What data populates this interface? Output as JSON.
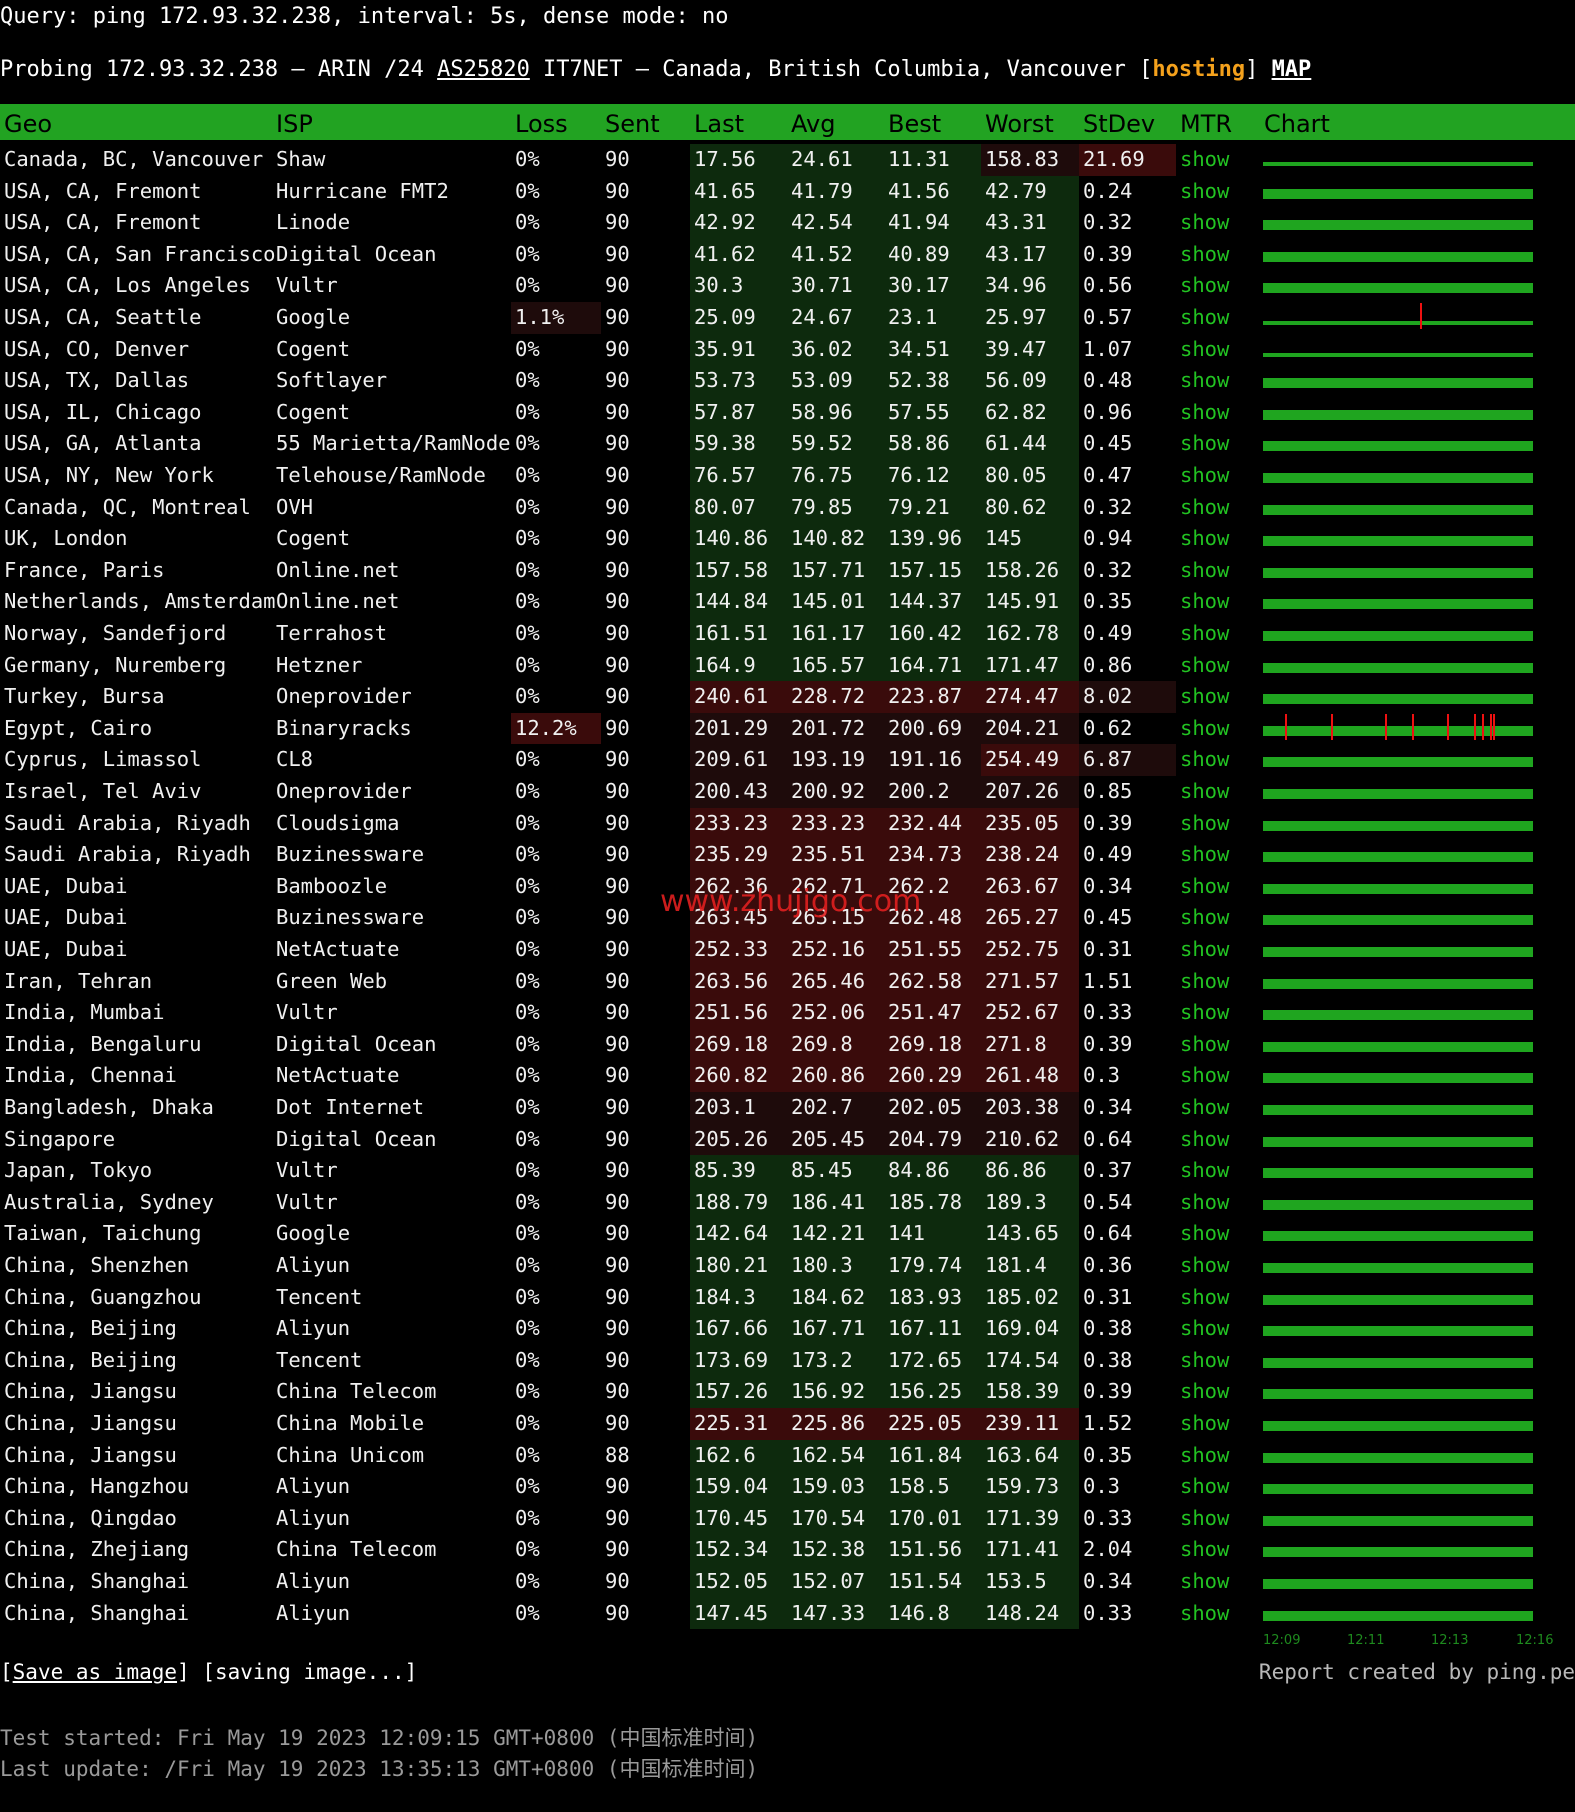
{
  "query": "Query: ping 172.93.32.238, interval: 5s, dense mode: no",
  "probe": {
    "prefix": "Probing 172.93.32.238 – ARIN /24 ",
    "asn": "AS25820",
    "suffix": " IT7NET – Canada, British Columbia, Vancouver [",
    "tag": "hosting",
    "close": "] ",
    "map": "MAP"
  },
  "headers": [
    "Geo",
    "ISP",
    "Loss",
    "Sent",
    "Last",
    "Avg",
    "Best",
    "Worst",
    "StDev",
    "MTR",
    "Chart"
  ],
  "colors": {
    "header_bg": "#22a322",
    "show_link": "#22c322",
    "hosting": "#f4a11c",
    "loss_spike": "#ee1111",
    "chart_bar": "#1fa51f"
  },
  "rows": [
    {
      "geo": "Canada, BC, Vancouver",
      "isp": "Shaw",
      "loss": "0%",
      "sent": "90",
      "last": "17.56",
      "avg": "24.61",
      "best": "11.31",
      "worst": "158.83",
      "stdev": "21.69",
      "mtr": "show",
      "lat": "green",
      "worst_flag": "dark",
      "stdev_flag": "red",
      "loss_flag": "none",
      "chart": "jitter",
      "spikes": []
    },
    {
      "geo": "USA, CA, Fremont",
      "isp": "Hurricane FMT2",
      "loss": "0%",
      "sent": "90",
      "last": "41.65",
      "avg": "41.79",
      "best": "41.56",
      "worst": "42.79",
      "stdev": "0.24",
      "mtr": "show",
      "lat": "green",
      "worst_flag": "green",
      "stdev_flag": "none",
      "loss_flag": "none",
      "chart": "solid",
      "spikes": []
    },
    {
      "geo": "USA, CA, Fremont",
      "isp": "Linode",
      "loss": "0%",
      "sent": "90",
      "last": "42.92",
      "avg": "42.54",
      "best": "41.94",
      "worst": "43.31",
      "stdev": "0.32",
      "mtr": "show",
      "lat": "green",
      "worst_flag": "green",
      "stdev_flag": "none",
      "loss_flag": "none",
      "chart": "solid",
      "spikes": []
    },
    {
      "geo": "USA, CA, San Francisco",
      "isp": "Digital Ocean",
      "loss": "0%",
      "sent": "90",
      "last": "41.62",
      "avg": "41.52",
      "best": "40.89",
      "worst": "43.17",
      "stdev": "0.39",
      "mtr": "show",
      "lat": "green",
      "worst_flag": "green",
      "stdev_flag": "none",
      "loss_flag": "none",
      "chart": "solid",
      "spikes": []
    },
    {
      "geo": "USA, CA, Los Angeles",
      "isp": "Vultr",
      "loss": "0%",
      "sent": "90",
      "last": "30.3",
      "avg": "30.71",
      "best": "30.17",
      "worst": "34.96",
      "stdev": "0.56",
      "mtr": "show",
      "lat": "green",
      "worst_flag": "green",
      "stdev_flag": "none",
      "loss_flag": "none",
      "chart": "solid",
      "spikes": []
    },
    {
      "geo": "USA, CA, Seattle",
      "isp": "Google",
      "loss": "1.1%",
      "sent": "90",
      "last": "25.09",
      "avg": "24.67",
      "best": "23.1",
      "worst": "25.97",
      "stdev": "0.57",
      "mtr": "show",
      "lat": "green",
      "worst_flag": "green",
      "stdev_flag": "none",
      "loss_flag": "dim",
      "chart": "thin",
      "spikes": [
        0.58
      ]
    },
    {
      "geo": "USA, CO, Denver",
      "isp": "Cogent",
      "loss": "0%",
      "sent": "90",
      "last": "35.91",
      "avg": "36.02",
      "best": "34.51",
      "worst": "39.47",
      "stdev": "1.07",
      "mtr": "show",
      "lat": "green",
      "worst_flag": "green",
      "stdev_flag": "none",
      "loss_flag": "none",
      "chart": "thin",
      "spikes": []
    },
    {
      "geo": "USA, TX, Dallas",
      "isp": "Softlayer",
      "loss": "0%",
      "sent": "90",
      "last": "53.73",
      "avg": "53.09",
      "best": "52.38",
      "worst": "56.09",
      "stdev": "0.48",
      "mtr": "show",
      "lat": "green",
      "worst_flag": "green",
      "stdev_flag": "none",
      "loss_flag": "none",
      "chart": "solid",
      "spikes": []
    },
    {
      "geo": "USA, IL, Chicago",
      "isp": "Cogent",
      "loss": "0%",
      "sent": "90",
      "last": "57.87",
      "avg": "58.96",
      "best": "57.55",
      "worst": "62.82",
      "stdev": "0.96",
      "mtr": "show",
      "lat": "green",
      "worst_flag": "green",
      "stdev_flag": "none",
      "loss_flag": "none",
      "chart": "solid",
      "spikes": []
    },
    {
      "geo": "USA, GA, Atlanta",
      "isp": "55 Marietta/RamNode",
      "loss": "0%",
      "sent": "90",
      "last": "59.38",
      "avg": "59.52",
      "best": "58.86",
      "worst": "61.44",
      "stdev": "0.45",
      "mtr": "show",
      "lat": "green",
      "worst_flag": "green",
      "stdev_flag": "none",
      "loss_flag": "none",
      "chart": "solid",
      "spikes": []
    },
    {
      "geo": "USA, NY, New York",
      "isp": "Telehouse/RamNode",
      "loss": "0%",
      "sent": "90",
      "last": "76.57",
      "avg": "76.75",
      "best": "76.12",
      "worst": "80.05",
      "stdev": "0.47",
      "mtr": "show",
      "lat": "green",
      "worst_flag": "green",
      "stdev_flag": "none",
      "loss_flag": "none",
      "chart": "solid",
      "spikes": []
    },
    {
      "geo": "Canada, QC, Montreal",
      "isp": "OVH",
      "loss": "0%",
      "sent": "90",
      "last": "80.07",
      "avg": "79.85",
      "best": "79.21",
      "worst": "80.62",
      "stdev": "0.32",
      "mtr": "show",
      "lat": "green",
      "worst_flag": "green",
      "stdev_flag": "none",
      "loss_flag": "none",
      "chart": "solid",
      "spikes": []
    },
    {
      "geo": "UK, London",
      "isp": "Cogent",
      "loss": "0%",
      "sent": "90",
      "last": "140.86",
      "avg": "140.82",
      "best": "139.96",
      "worst": "145",
      "stdev": "0.94",
      "mtr": "show",
      "lat": "green",
      "worst_flag": "green",
      "stdev_flag": "none",
      "loss_flag": "none",
      "chart": "solid",
      "spikes": []
    },
    {
      "geo": "France, Paris",
      "isp": "Online.net",
      "loss": "0%",
      "sent": "90",
      "last": "157.58",
      "avg": "157.71",
      "best": "157.15",
      "worst": "158.26",
      "stdev": "0.32",
      "mtr": "show",
      "lat": "green",
      "worst_flag": "green",
      "stdev_flag": "none",
      "loss_flag": "none",
      "chart": "solid",
      "spikes": []
    },
    {
      "geo": "Netherlands, Amsterdam",
      "isp": "Online.net",
      "loss": "0%",
      "sent": "90",
      "last": "144.84",
      "avg": "145.01",
      "best": "144.37",
      "worst": "145.91",
      "stdev": "0.35",
      "mtr": "show",
      "lat": "green",
      "worst_flag": "green",
      "stdev_flag": "none",
      "loss_flag": "none",
      "chart": "solid",
      "spikes": []
    },
    {
      "geo": "Norway, Sandefjord",
      "isp": "Terrahost",
      "loss": "0%",
      "sent": "90",
      "last": "161.51",
      "avg": "161.17",
      "best": "160.42",
      "worst": "162.78",
      "stdev": "0.49",
      "mtr": "show",
      "lat": "green",
      "worst_flag": "green",
      "stdev_flag": "none",
      "loss_flag": "none",
      "chart": "solid",
      "spikes": []
    },
    {
      "geo": "Germany, Nuremberg",
      "isp": "Hetzner",
      "loss": "0%",
      "sent": "90",
      "last": "164.9",
      "avg": "165.57",
      "best": "164.71",
      "worst": "171.47",
      "stdev": "0.86",
      "mtr": "show",
      "lat": "green",
      "worst_flag": "green",
      "stdev_flag": "none",
      "loss_flag": "none",
      "chart": "solid",
      "spikes": []
    },
    {
      "geo": "Turkey, Bursa",
      "isp": "Oneprovider",
      "loss": "0%",
      "sent": "90",
      "last": "240.61",
      "avg": "228.72",
      "best": "223.87",
      "worst": "274.47",
      "stdev": "8.02",
      "mtr": "show",
      "lat": "red",
      "worst_flag": "red",
      "stdev_flag": "dark",
      "loss_flag": "none",
      "chart": "solid",
      "spikes": []
    },
    {
      "geo": "Egypt, Cairo",
      "isp": "Binaryracks",
      "loss": "12.2%",
      "sent": "90",
      "last": "201.29",
      "avg": "201.72",
      "best": "200.69",
      "worst": "204.21",
      "stdev": "0.62",
      "mtr": "show",
      "lat": "dark",
      "worst_flag": "dark",
      "stdev_flag": "none",
      "loss_flag": "red",
      "chart": "solid",
      "spikes": [
        0.08,
        0.25,
        0.45,
        0.55,
        0.68,
        0.78,
        0.81,
        0.84,
        0.85
      ]
    },
    {
      "geo": "Cyprus, Limassol",
      "isp": "CL8",
      "loss": "0%",
      "sent": "90",
      "last": "209.61",
      "avg": "193.19",
      "best": "191.16",
      "worst": "254.49",
      "stdev": "6.87",
      "mtr": "show",
      "lat": "dark",
      "worst_flag": "red",
      "stdev_flag": "dark",
      "loss_flag": "none",
      "chart": "solid",
      "spikes": []
    },
    {
      "geo": "Israel, Tel Aviv",
      "isp": "Oneprovider",
      "loss": "0%",
      "sent": "90",
      "last": "200.43",
      "avg": "200.92",
      "best": "200.2",
      "worst": "207.26",
      "stdev": "0.85",
      "mtr": "show",
      "lat": "dark",
      "worst_flag": "dark",
      "stdev_flag": "none",
      "loss_flag": "none",
      "chart": "solid",
      "spikes": []
    },
    {
      "geo": "Saudi Arabia, Riyadh",
      "isp": "Cloudsigma",
      "loss": "0%",
      "sent": "90",
      "last": "233.23",
      "avg": "233.23",
      "best": "232.44",
      "worst": "235.05",
      "stdev": "0.39",
      "mtr": "show",
      "lat": "red",
      "worst_flag": "red",
      "stdev_flag": "none",
      "loss_flag": "none",
      "chart": "solid",
      "spikes": []
    },
    {
      "geo": "Saudi Arabia, Riyadh",
      "isp": "Buzinessware",
      "loss": "0%",
      "sent": "90",
      "last": "235.29",
      "avg": "235.51",
      "best": "234.73",
      "worst": "238.24",
      "stdev": "0.49",
      "mtr": "show",
      "lat": "red",
      "worst_flag": "red",
      "stdev_flag": "none",
      "loss_flag": "none",
      "chart": "solid",
      "spikes": []
    },
    {
      "geo": "UAE, Dubai",
      "isp": "Bamboozle",
      "loss": "0%",
      "sent": "90",
      "last": "262.36",
      "avg": "262.71",
      "best": "262.2",
      "worst": "263.67",
      "stdev": "0.34",
      "mtr": "show",
      "lat": "red",
      "worst_flag": "red",
      "stdev_flag": "none",
      "loss_flag": "none",
      "chart": "solid",
      "spikes": []
    },
    {
      "geo": "UAE, Dubai",
      "isp": "Buzinessware",
      "loss": "0%",
      "sent": "90",
      "last": "263.45",
      "avg": "263.15",
      "best": "262.48",
      "worst": "265.27",
      "stdev": "0.45",
      "mtr": "show",
      "lat": "red",
      "worst_flag": "red",
      "stdev_flag": "none",
      "loss_flag": "none",
      "chart": "solid",
      "spikes": []
    },
    {
      "geo": "UAE, Dubai",
      "isp": "NetActuate",
      "loss": "0%",
      "sent": "90",
      "last": "252.33",
      "avg": "252.16",
      "best": "251.55",
      "worst": "252.75",
      "stdev": "0.31",
      "mtr": "show",
      "lat": "red",
      "worst_flag": "red",
      "stdev_flag": "none",
      "loss_flag": "none",
      "chart": "solid",
      "spikes": []
    },
    {
      "geo": "Iran, Tehran",
      "isp": "Green Web",
      "loss": "0%",
      "sent": "90",
      "last": "263.56",
      "avg": "265.46",
      "best": "262.58",
      "worst": "271.57",
      "stdev": "1.51",
      "mtr": "show",
      "lat": "red",
      "worst_flag": "red",
      "stdev_flag": "none",
      "loss_flag": "none",
      "chart": "solid",
      "spikes": []
    },
    {
      "geo": "India, Mumbai",
      "isp": "Vultr",
      "loss": "0%",
      "sent": "90",
      "last": "251.56",
      "avg": "252.06",
      "best": "251.47",
      "worst": "252.67",
      "stdev": "0.33",
      "mtr": "show",
      "lat": "red",
      "worst_flag": "red",
      "stdev_flag": "none",
      "loss_flag": "none",
      "chart": "solid",
      "spikes": []
    },
    {
      "geo": "India, Bengaluru",
      "isp": "Digital Ocean",
      "loss": "0%",
      "sent": "90",
      "last": "269.18",
      "avg": "269.8",
      "best": "269.18",
      "worst": "271.8",
      "stdev": "0.39",
      "mtr": "show",
      "lat": "red",
      "worst_flag": "red",
      "stdev_flag": "none",
      "loss_flag": "none",
      "chart": "solid",
      "spikes": []
    },
    {
      "geo": "India, Chennai",
      "isp": "NetActuate",
      "loss": "0%",
      "sent": "90",
      "last": "260.82",
      "avg": "260.86",
      "best": "260.29",
      "worst": "261.48",
      "stdev": "0.3",
      "mtr": "show",
      "lat": "red",
      "worst_flag": "red",
      "stdev_flag": "none",
      "loss_flag": "none",
      "chart": "solid",
      "spikes": []
    },
    {
      "geo": "Bangladesh, Dhaka",
      "isp": "Dot Internet",
      "loss": "0%",
      "sent": "90",
      "last": "203.1",
      "avg": "202.7",
      "best": "202.05",
      "worst": "203.38",
      "stdev": "0.34",
      "mtr": "show",
      "lat": "dark",
      "worst_flag": "dark",
      "stdev_flag": "none",
      "loss_flag": "none",
      "chart": "solid",
      "spikes": []
    },
    {
      "geo": "Singapore",
      "isp": "Digital Ocean",
      "loss": "0%",
      "sent": "90",
      "last": "205.26",
      "avg": "205.45",
      "best": "204.79",
      "worst": "210.62",
      "stdev": "0.64",
      "mtr": "show",
      "lat": "dark",
      "worst_flag": "dark",
      "stdev_flag": "none",
      "loss_flag": "none",
      "chart": "solid",
      "spikes": []
    },
    {
      "geo": "Japan, Tokyo",
      "isp": "Vultr",
      "loss": "0%",
      "sent": "90",
      "last": "85.39",
      "avg": "85.45",
      "best": "84.86",
      "worst": "86.86",
      "stdev": "0.37",
      "mtr": "show",
      "lat": "green",
      "worst_flag": "green",
      "stdev_flag": "none",
      "loss_flag": "none",
      "chart": "solid",
      "spikes": []
    },
    {
      "geo": "Australia, Sydney",
      "isp": "Vultr",
      "loss": "0%",
      "sent": "90",
      "last": "188.79",
      "avg": "186.41",
      "best": "185.78",
      "worst": "189.3",
      "stdev": "0.54",
      "mtr": "show",
      "lat": "green",
      "worst_flag": "green",
      "stdev_flag": "none",
      "loss_flag": "none",
      "chart": "solid",
      "spikes": []
    },
    {
      "geo": "Taiwan, Taichung",
      "isp": "Google",
      "loss": "0%",
      "sent": "90",
      "last": "142.64",
      "avg": "142.21",
      "best": "141",
      "worst": "143.65",
      "stdev": "0.64",
      "mtr": "show",
      "lat": "green",
      "worst_flag": "green",
      "stdev_flag": "none",
      "loss_flag": "none",
      "chart": "solid",
      "spikes": []
    },
    {
      "geo": "China, Shenzhen",
      "isp": "Aliyun",
      "loss": "0%",
      "sent": "90",
      "last": "180.21",
      "avg": "180.3",
      "best": "179.74",
      "worst": "181.4",
      "stdev": "0.36",
      "mtr": "show",
      "lat": "green",
      "worst_flag": "green",
      "stdev_flag": "none",
      "loss_flag": "none",
      "chart": "solid",
      "spikes": []
    },
    {
      "geo": "China, Guangzhou",
      "isp": "Tencent",
      "loss": "0%",
      "sent": "90",
      "last": "184.3",
      "avg": "184.62",
      "best": "183.93",
      "worst": "185.02",
      "stdev": "0.31",
      "mtr": "show",
      "lat": "green",
      "worst_flag": "green",
      "stdev_flag": "none",
      "loss_flag": "none",
      "chart": "solid",
      "spikes": []
    },
    {
      "geo": "China, Beijing",
      "isp": "Aliyun",
      "loss": "0%",
      "sent": "90",
      "last": "167.66",
      "avg": "167.71",
      "best": "167.11",
      "worst": "169.04",
      "stdev": "0.38",
      "mtr": "show",
      "lat": "green",
      "worst_flag": "green",
      "stdev_flag": "none",
      "loss_flag": "none",
      "chart": "solid",
      "spikes": []
    },
    {
      "geo": "China, Beijing",
      "isp": "Tencent",
      "loss": "0%",
      "sent": "90",
      "last": "173.69",
      "avg": "173.2",
      "best": "172.65",
      "worst": "174.54",
      "stdev": "0.38",
      "mtr": "show",
      "lat": "green",
      "worst_flag": "green",
      "stdev_flag": "none",
      "loss_flag": "none",
      "chart": "solid",
      "spikes": []
    },
    {
      "geo": "China, Jiangsu",
      "isp": "China Telecom",
      "loss": "0%",
      "sent": "90",
      "last": "157.26",
      "avg": "156.92",
      "best": "156.25",
      "worst": "158.39",
      "stdev": "0.39",
      "mtr": "show",
      "lat": "green",
      "worst_flag": "green",
      "stdev_flag": "none",
      "loss_flag": "none",
      "chart": "solid",
      "spikes": []
    },
    {
      "geo": "China, Jiangsu",
      "isp": "China Mobile",
      "loss": "0%",
      "sent": "90",
      "last": "225.31",
      "avg": "225.86",
      "best": "225.05",
      "worst": "239.11",
      "stdev": "1.52",
      "mtr": "show",
      "lat": "red",
      "worst_flag": "red",
      "stdev_flag": "none",
      "loss_flag": "none",
      "chart": "solid",
      "spikes": []
    },
    {
      "geo": "China, Jiangsu",
      "isp": "China Unicom",
      "loss": "0%",
      "sent": "88",
      "last": "162.6",
      "avg": "162.54",
      "best": "161.84",
      "worst": "163.64",
      "stdev": "0.35",
      "mtr": "show",
      "lat": "green",
      "worst_flag": "green",
      "stdev_flag": "none",
      "loss_flag": "none",
      "chart": "solid",
      "spikes": []
    },
    {
      "geo": "China, Hangzhou",
      "isp": "Aliyun",
      "loss": "0%",
      "sent": "90",
      "last": "159.04",
      "avg": "159.03",
      "best": "158.5",
      "worst": "159.73",
      "stdev": "0.3",
      "mtr": "show",
      "lat": "green",
      "worst_flag": "green",
      "stdev_flag": "none",
      "loss_flag": "none",
      "chart": "solid",
      "spikes": []
    },
    {
      "geo": "China, Qingdao",
      "isp": "Aliyun",
      "loss": "0%",
      "sent": "90",
      "last": "170.45",
      "avg": "170.54",
      "best": "170.01",
      "worst": "171.39",
      "stdev": "0.33",
      "mtr": "show",
      "lat": "green",
      "worst_flag": "green",
      "stdev_flag": "none",
      "loss_flag": "none",
      "chart": "solid",
      "spikes": []
    },
    {
      "geo": "China, Zhejiang",
      "isp": "China Telecom",
      "loss": "0%",
      "sent": "90",
      "last": "152.34",
      "avg": "152.38",
      "best": "151.56",
      "worst": "171.41",
      "stdev": "2.04",
      "mtr": "show",
      "lat": "green",
      "worst_flag": "green",
      "stdev_flag": "none",
      "loss_flag": "none",
      "chart": "solid",
      "spikes": []
    },
    {
      "geo": "China, Shanghai",
      "isp": "Aliyun",
      "loss": "0%",
      "sent": "90",
      "last": "152.05",
      "avg": "152.07",
      "best": "151.54",
      "worst": "153.5",
      "stdev": "0.34",
      "mtr": "show",
      "lat": "green",
      "worst_flag": "green",
      "stdev_flag": "none",
      "loss_flag": "none",
      "chart": "solid",
      "spikes": []
    },
    {
      "geo": "China, Shanghai",
      "isp": "Aliyun",
      "loss": "0%",
      "sent": "90",
      "last": "147.45",
      "avg": "147.33",
      "best": "146.8",
      "worst": "148.24",
      "stdev": "0.33",
      "mtr": "show",
      "lat": "green",
      "worst_flag": "green",
      "stdev_flag": "none",
      "loss_flag": "none",
      "chart": "solid",
      "spikes": []
    }
  ],
  "chart_axis": [
    "12:09",
    "12:11",
    "12:13",
    "12:16"
  ],
  "footer": {
    "save_open": "[",
    "save_label": "Save as image",
    "save_rest": "] [saving image...]",
    "credit": "Report created by ping.pe",
    "started": "Test started: Fri May 19 2023 12:09:15 GMT+0800 (中国标准时间)",
    "updated": "Last update: /Fri May 19 2023 13:35:13 GMT+0800 (中国标准时间)"
  },
  "watermark": "www.zhujigo.com"
}
